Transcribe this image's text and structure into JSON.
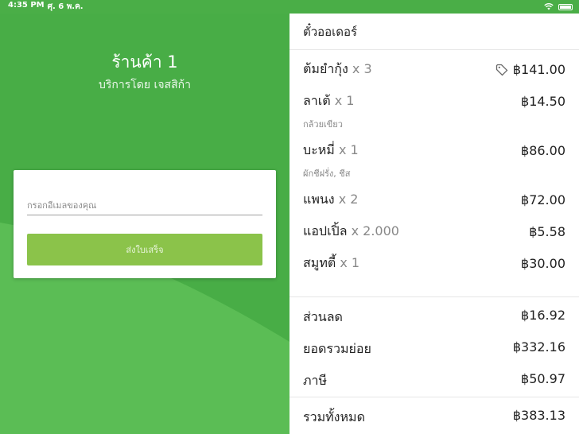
{
  "status_bar": {
    "time": "4:35 PM",
    "date": "ศุ. 6 พ.ค."
  },
  "store": {
    "name": "ร้านค้า 1",
    "subtitle": "บริการโดย เจสสิก้า"
  },
  "receipt_form": {
    "email_placeholder": "กรอกอีเมลของคุณ",
    "send_label": "ส่งใบเสร็จ"
  },
  "ticket": {
    "title": "ตั๋วออเดอร์",
    "items": [
      {
        "name": "ต้มยำกุ้ง",
        "qty": "x 3",
        "note": "",
        "price": "฿141.00",
        "has_tag_icon": true
      },
      {
        "name": "ลาเต้",
        "qty": "x 1",
        "note": "กล้วยเขียว",
        "price": "฿14.50",
        "has_tag_icon": false
      },
      {
        "name": "บะหมี่",
        "qty": "x 1",
        "note": "ผักชีฝรั่ง, ชีส",
        "price": "฿86.00",
        "has_tag_icon": false
      },
      {
        "name": "แพนง",
        "qty": "x 2",
        "note": "",
        "price": "฿72.00",
        "has_tag_icon": false
      },
      {
        "name": "แอปเปิ้ล",
        "qty": "x 2.000",
        "note": "",
        "price": "฿5.58",
        "has_tag_icon": false
      },
      {
        "name": "สมูทตี้",
        "qty": "x 1",
        "note": "",
        "price": "฿30.00",
        "has_tag_icon": false
      }
    ],
    "discount_label": "ส่วนลด",
    "discount_value": "฿16.92",
    "subtotal_label": "ยอดรวมย่อย",
    "subtotal_value": "฿332.16",
    "tax_label": "ภาษี",
    "tax_value": "฿50.97",
    "total_label": "รวมทั้งหมด",
    "total_value": "฿383.13"
  },
  "colors": {
    "brand_green": "#48ad46",
    "button_green": "#8bc34a"
  }
}
